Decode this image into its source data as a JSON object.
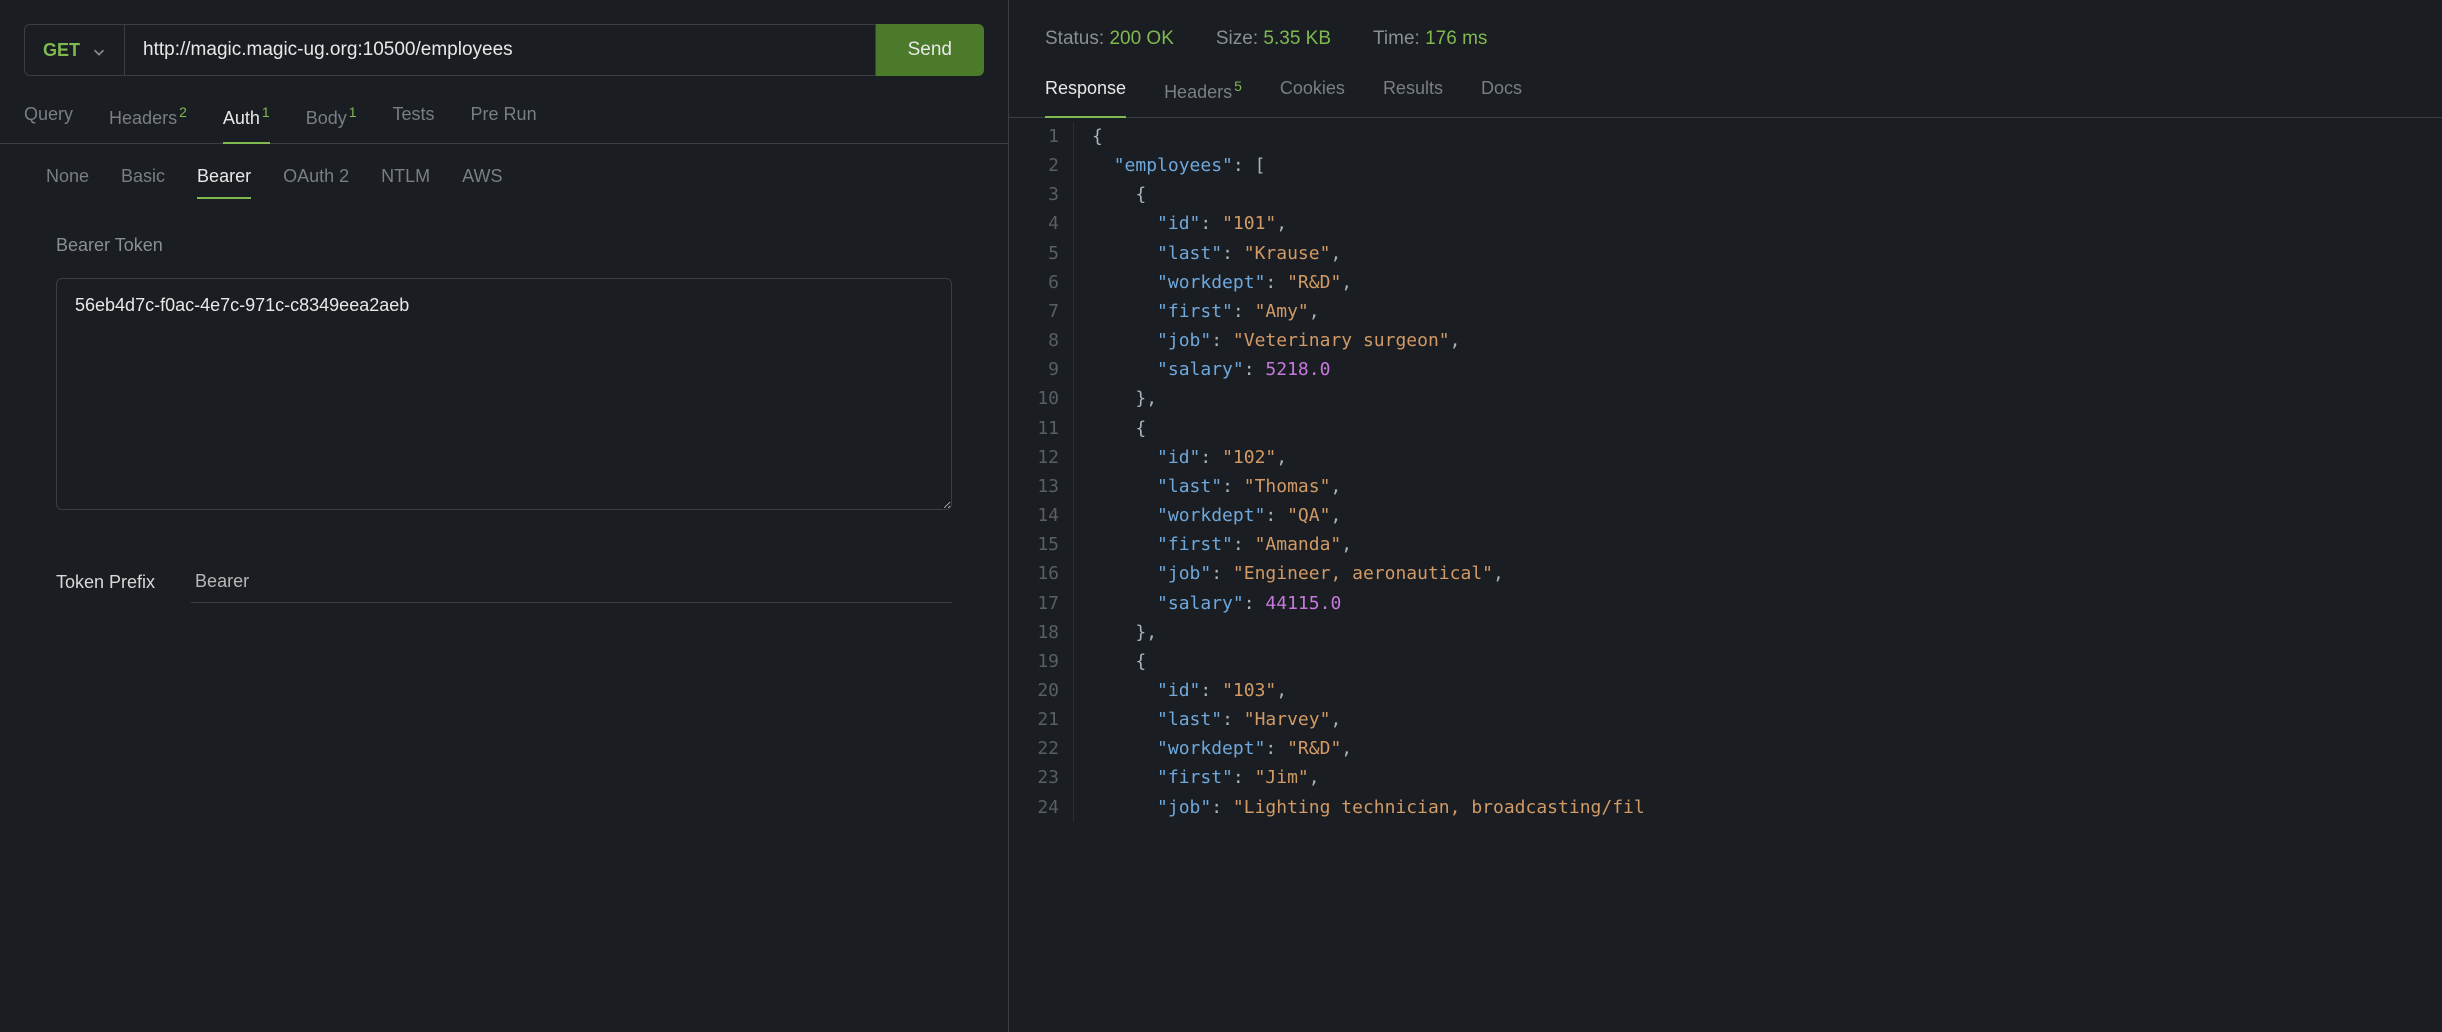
{
  "request": {
    "method": "GET",
    "url": "http://magic.magic-ug.org:10500/employees",
    "send_label": "Send"
  },
  "tabs": {
    "query": "Query",
    "headers": "Headers",
    "headers_count": "2",
    "auth": "Auth",
    "auth_count": "1",
    "body": "Body",
    "body_count": "1",
    "tests": "Tests",
    "prerun": "Pre Run"
  },
  "auth": {
    "subtabs": {
      "none": "None",
      "basic": "Basic",
      "bearer": "Bearer",
      "oauth2": "OAuth 2",
      "ntlm": "NTLM",
      "aws": "AWS"
    },
    "token_label": "Bearer Token",
    "token_value": "56eb4d7c-f0ac-4e7c-971c-c8349eea2aeb",
    "prefix_label": "Token Prefix",
    "prefix_value": "Bearer"
  },
  "response": {
    "status_label": "Status:",
    "status_value": "200 OK",
    "size_label": "Size:",
    "size_value": "5.35 KB",
    "time_label": "Time:",
    "time_value": "176 ms",
    "tabs": {
      "response": "Response",
      "headers": "Headers",
      "headers_count": "5",
      "cookies": "Cookies",
      "results": "Results",
      "docs": "Docs"
    },
    "json_lines": [
      {
        "n": 1,
        "tokens": [
          [
            "punc",
            "{"
          ]
        ]
      },
      {
        "n": 2,
        "indent": 1,
        "tokens": [
          [
            "key",
            "\"employees\""
          ],
          [
            "punc",
            ": ["
          ]
        ]
      },
      {
        "n": 3,
        "indent": 2,
        "tokens": [
          [
            "punc",
            "{"
          ]
        ]
      },
      {
        "n": 4,
        "indent": 3,
        "tokens": [
          [
            "key",
            "\"id\""
          ],
          [
            "punc",
            ": "
          ],
          [
            "str",
            "\"101\""
          ],
          [
            "punc",
            ","
          ]
        ]
      },
      {
        "n": 5,
        "indent": 3,
        "tokens": [
          [
            "key",
            "\"last\""
          ],
          [
            "punc",
            ": "
          ],
          [
            "str",
            "\"Krause\""
          ],
          [
            "punc",
            ","
          ]
        ]
      },
      {
        "n": 6,
        "indent": 3,
        "tokens": [
          [
            "key",
            "\"workdept\""
          ],
          [
            "punc",
            ": "
          ],
          [
            "str",
            "\"R&D\""
          ],
          [
            "punc",
            ","
          ]
        ]
      },
      {
        "n": 7,
        "indent": 3,
        "tokens": [
          [
            "key",
            "\"first\""
          ],
          [
            "punc",
            ": "
          ],
          [
            "str",
            "\"Amy\""
          ],
          [
            "punc",
            ","
          ]
        ]
      },
      {
        "n": 8,
        "indent": 3,
        "tokens": [
          [
            "key",
            "\"job\""
          ],
          [
            "punc",
            ": "
          ],
          [
            "str",
            "\"Veterinary surgeon\""
          ],
          [
            "punc",
            ","
          ]
        ]
      },
      {
        "n": 9,
        "indent": 3,
        "tokens": [
          [
            "key",
            "\"salary\""
          ],
          [
            "punc",
            ": "
          ],
          [
            "num",
            "5218.0"
          ]
        ]
      },
      {
        "n": 10,
        "indent": 2,
        "tokens": [
          [
            "punc",
            "},"
          ]
        ]
      },
      {
        "n": 11,
        "indent": 2,
        "tokens": [
          [
            "punc",
            "{"
          ]
        ]
      },
      {
        "n": 12,
        "indent": 3,
        "tokens": [
          [
            "key",
            "\"id\""
          ],
          [
            "punc",
            ": "
          ],
          [
            "str",
            "\"102\""
          ],
          [
            "punc",
            ","
          ]
        ]
      },
      {
        "n": 13,
        "indent": 3,
        "tokens": [
          [
            "key",
            "\"last\""
          ],
          [
            "punc",
            ": "
          ],
          [
            "str",
            "\"Thomas\""
          ],
          [
            "punc",
            ","
          ]
        ]
      },
      {
        "n": 14,
        "indent": 3,
        "tokens": [
          [
            "key",
            "\"workdept\""
          ],
          [
            "punc",
            ": "
          ],
          [
            "str",
            "\"QA\""
          ],
          [
            "punc",
            ","
          ]
        ]
      },
      {
        "n": 15,
        "indent": 3,
        "tokens": [
          [
            "key",
            "\"first\""
          ],
          [
            "punc",
            ": "
          ],
          [
            "str",
            "\"Amanda\""
          ],
          [
            "punc",
            ","
          ]
        ]
      },
      {
        "n": 16,
        "indent": 3,
        "tokens": [
          [
            "key",
            "\"job\""
          ],
          [
            "punc",
            ": "
          ],
          [
            "str",
            "\"Engineer, aeronautical\""
          ],
          [
            "punc",
            ","
          ]
        ]
      },
      {
        "n": 17,
        "indent": 3,
        "tokens": [
          [
            "key",
            "\"salary\""
          ],
          [
            "punc",
            ": "
          ],
          [
            "num",
            "44115.0"
          ]
        ]
      },
      {
        "n": 18,
        "indent": 2,
        "tokens": [
          [
            "punc",
            "},"
          ]
        ]
      },
      {
        "n": 19,
        "indent": 2,
        "tokens": [
          [
            "punc",
            "{"
          ]
        ]
      },
      {
        "n": 20,
        "indent": 3,
        "tokens": [
          [
            "key",
            "\"id\""
          ],
          [
            "punc",
            ": "
          ],
          [
            "str",
            "\"103\""
          ],
          [
            "punc",
            ","
          ]
        ]
      },
      {
        "n": 21,
        "indent": 3,
        "tokens": [
          [
            "key",
            "\"last\""
          ],
          [
            "punc",
            ": "
          ],
          [
            "str",
            "\"Harvey\""
          ],
          [
            "punc",
            ","
          ]
        ]
      },
      {
        "n": 22,
        "indent": 3,
        "tokens": [
          [
            "key",
            "\"workdept\""
          ],
          [
            "punc",
            ": "
          ],
          [
            "str",
            "\"R&D\""
          ],
          [
            "punc",
            ","
          ]
        ]
      },
      {
        "n": 23,
        "indent": 3,
        "tokens": [
          [
            "key",
            "\"first\""
          ],
          [
            "punc",
            ": "
          ],
          [
            "str",
            "\"Jim\""
          ],
          [
            "punc",
            ","
          ]
        ]
      },
      {
        "n": 24,
        "indent": 3,
        "tokens": [
          [
            "key",
            "\"job\""
          ],
          [
            "punc",
            ": "
          ],
          [
            "str",
            "\"Lighting technician, broadcasting/fil"
          ]
        ]
      }
    ]
  }
}
